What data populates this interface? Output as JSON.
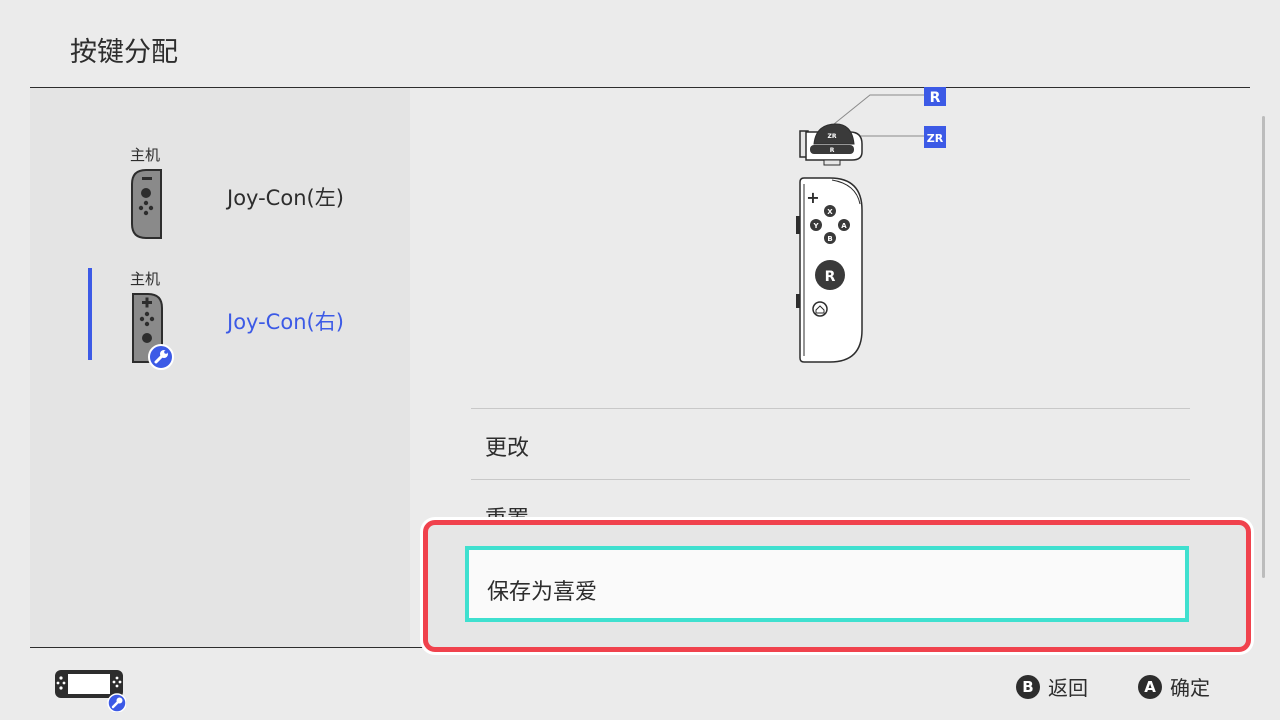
{
  "header": {
    "title": "按键分配"
  },
  "devices": [
    {
      "owner": "主机",
      "name": "Joy-Con(左)",
      "selected": false
    },
    {
      "owner": "主机",
      "name": "Joy-Con(右)",
      "selected": true
    }
  ],
  "diagram": {
    "badge_r": "R",
    "badge_zr": "ZR",
    "shoulder_zr": "ZR",
    "shoulder_r": "R",
    "buttons": {
      "x": "X",
      "y": "Y",
      "a": "A",
      "b": "B"
    },
    "stick": "R",
    "plus": "+"
  },
  "menu": {
    "items": [
      {
        "label": "更改"
      },
      {
        "label": "重置"
      },
      {
        "label": "保存为喜爱"
      }
    ],
    "focused_index": 2
  },
  "footer": {
    "back_key": "B",
    "back_label": "返回",
    "ok_key": "A",
    "ok_label": "确定"
  },
  "colors": {
    "accent": "#3c5ae6",
    "focus_outer": "#f0424d",
    "focus_inner": "#3fe0cf",
    "text": "#2d2d2d",
    "background": "#ebebeb"
  }
}
